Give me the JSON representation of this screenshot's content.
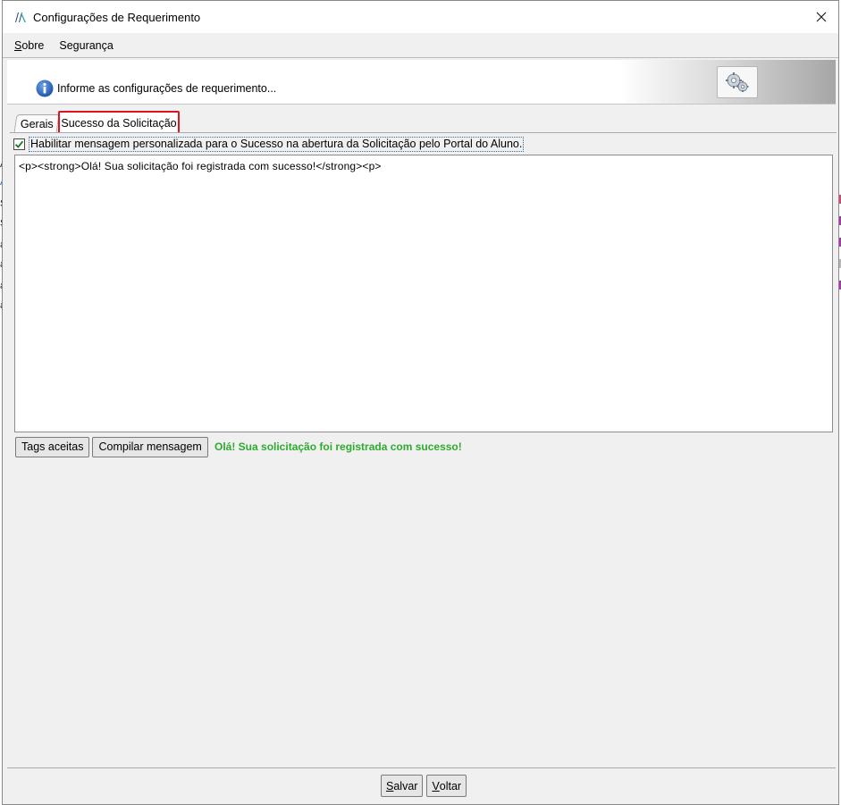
{
  "window": {
    "title": "Configurações de Requerimento"
  },
  "menu": {
    "items": [
      {
        "underline": "S",
        "rest": "obre"
      },
      {
        "underline": "",
        "rest": "Segurança"
      }
    ]
  },
  "header": {
    "info_text": "Informe as configurações de requerimento..."
  },
  "tabs": [
    {
      "label": "Gerais",
      "selected": false
    },
    {
      "label": "Sucesso da Solicitação",
      "selected": true
    }
  ],
  "form": {
    "checkbox_checked": true,
    "checkbox_label": "Habilitar mensagem personalizada para o Sucesso na abertura da Solicitação pelo Portal do Aluno.",
    "editor_content": "<p><strong>Olá! Sua solicitação foi registrada com sucesso!</strong><p>",
    "tags_button": "Tags aceitas",
    "compile_button": "Compilar mensagem",
    "compiled_preview": "Olá! Sua solicitação foi registrada com sucesso!"
  },
  "footer": {
    "save_underline": "S",
    "save_rest": "alvar",
    "back_underline": "V",
    "back_rest": "oltar"
  },
  "background_edge": {
    "letters": [
      "A",
      "A",
      "S",
      "S",
      "a",
      "a",
      "a",
      "a",
      "a"
    ]
  },
  "colors": {
    "highlight_border": "#e0141e",
    "success_text": "#2eaa2e",
    "info_blue": "#1e5bb5"
  }
}
